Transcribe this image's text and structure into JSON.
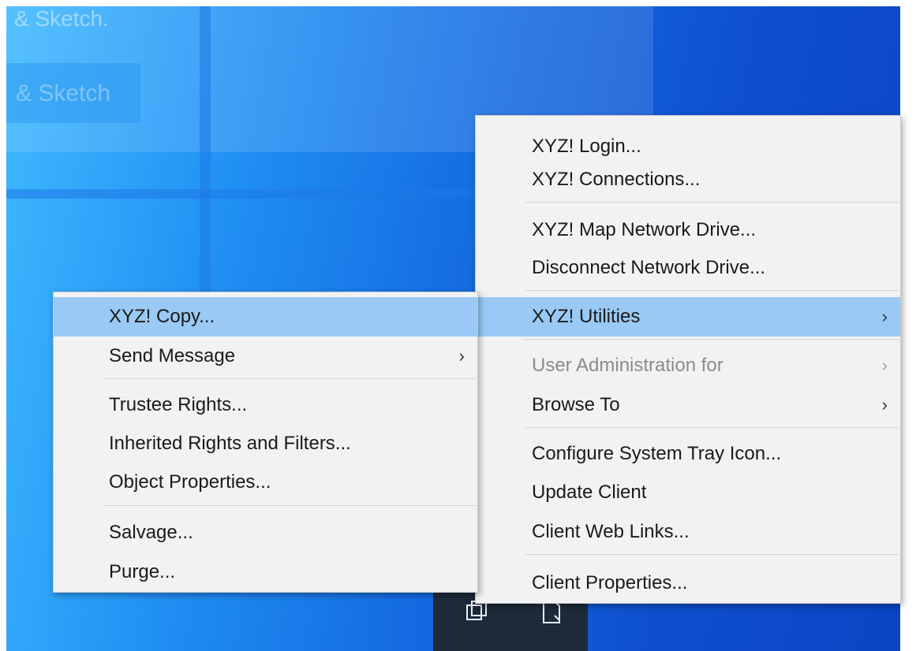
{
  "background": {
    "text_1": "& Sketch.",
    "text_2": "& Sketch"
  },
  "right_menu": {
    "items": [
      {
        "label": "XYZ! Login..."
      },
      {
        "label": "XYZ! Connections..."
      },
      {
        "label": "XYZ! Map Network Drive..."
      },
      {
        "label": "Disconnect Network Drive..."
      },
      {
        "label": "XYZ! Utilities",
        "submenu": true,
        "highlighted": true
      },
      {
        "label": "User Administration for",
        "submenu": true,
        "disabled": true
      },
      {
        "label": "Browse To",
        "submenu": true
      },
      {
        "label": "Configure System Tray Icon..."
      },
      {
        "label": "Update Client"
      },
      {
        "label": "Client Web Links..."
      },
      {
        "label": "Client Properties..."
      }
    ]
  },
  "left_menu": {
    "items": [
      {
        "label": "XYZ! Copy...",
        "highlighted": true
      },
      {
        "label": "Send Message",
        "submenu": true
      },
      {
        "label": "Trustee Rights..."
      },
      {
        "label": "Inherited Rights and Filters..."
      },
      {
        "label": "Object Properties..."
      },
      {
        "label": "Salvage..."
      },
      {
        "label": "Purge..."
      }
    ]
  },
  "glyphs": {
    "chevron": "›"
  },
  "taskbar": {
    "icons": [
      "copy-window-icon",
      "document-icon"
    ]
  },
  "colors": {
    "menu_background": "#f2f2f2",
    "highlight": "#99c9f4",
    "disabled_text": "#8c8c8c",
    "taskbar": "#1c2a3a"
  }
}
